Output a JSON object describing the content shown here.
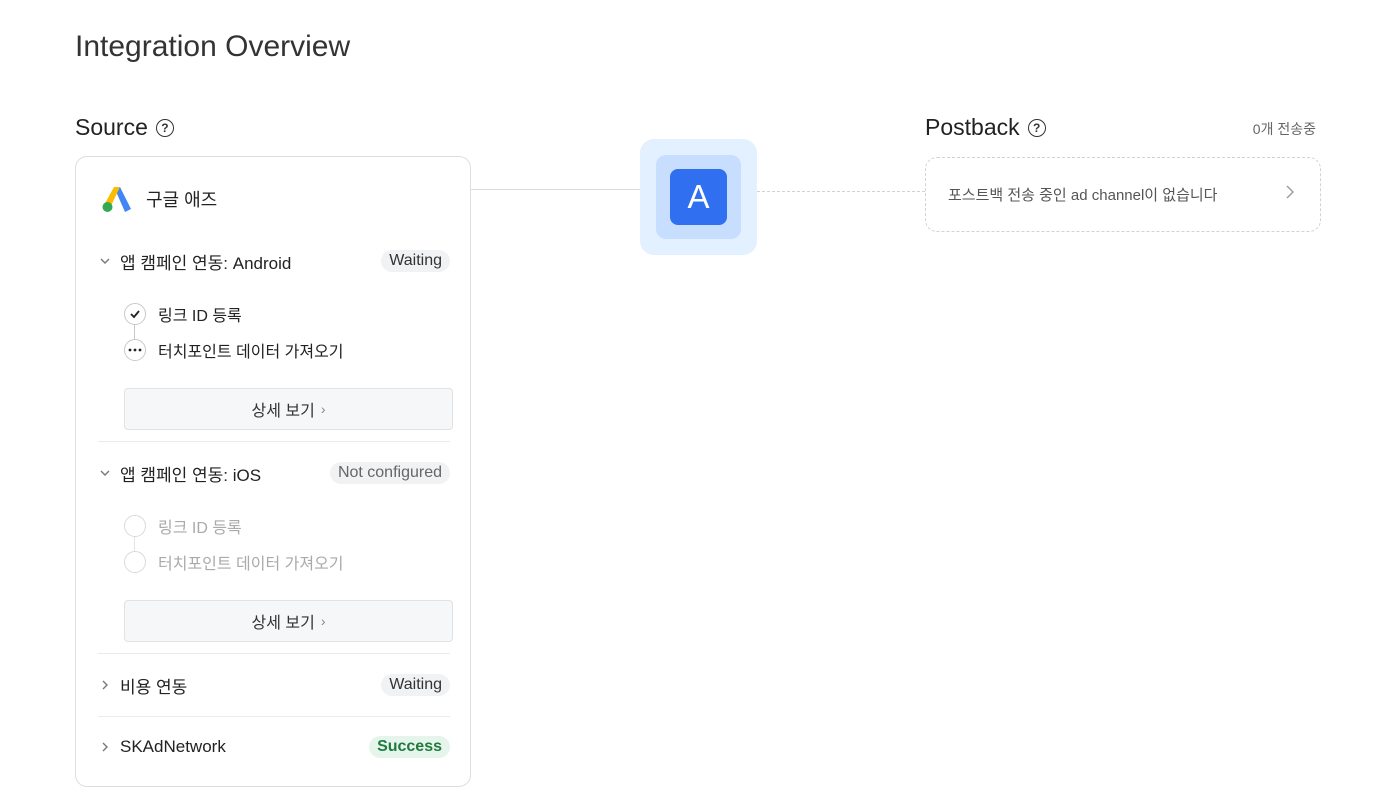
{
  "page": {
    "title": "Integration Overview"
  },
  "source": {
    "title": "Source",
    "help_icon": "?",
    "brand": "구글 애즈",
    "groups": [
      {
        "label": "앱 캠페인 연동: Android",
        "status": "Waiting",
        "steps": [
          {
            "label": "링크 ID 등록",
            "state": "done"
          },
          {
            "label": "터치포인트 데이터 가져오기",
            "state": "pending"
          }
        ],
        "detail_label": "상세 보기"
      },
      {
        "label": "앱 캠페인 연동: iOS",
        "status": "Not configured",
        "steps": [
          {
            "label": "링크 ID 등록",
            "state": "inactive"
          },
          {
            "label": "터치포인트 데이터 가져오기",
            "state": "inactive"
          }
        ],
        "detail_label": "상세 보기"
      },
      {
        "label": "비용 연동",
        "status": "Waiting"
      },
      {
        "label": "SKAdNetwork",
        "status": "Success"
      }
    ],
    "detail_arrow": "›"
  },
  "app": {
    "logo_letter": "A",
    "color": "#2f6ff0"
  },
  "postback": {
    "title": "Postback",
    "count": "0개 전송중",
    "empty_message": "포스트백 전송 중인 ad channel이 없습니다",
    "arrow": "›"
  },
  "colors": {
    "success_bg": "#e5f5eb",
    "success_text": "#1f7a3e",
    "badge_bg": "#f1f2f4"
  },
  "icons": {
    "help": "question-circle-icon",
    "google_ads": "google-ads-logo-icon",
    "expand": "chevron-down-icon",
    "collapse": "chevron-right-icon",
    "check": "check-icon",
    "pending": "ellipsis-icon"
  }
}
